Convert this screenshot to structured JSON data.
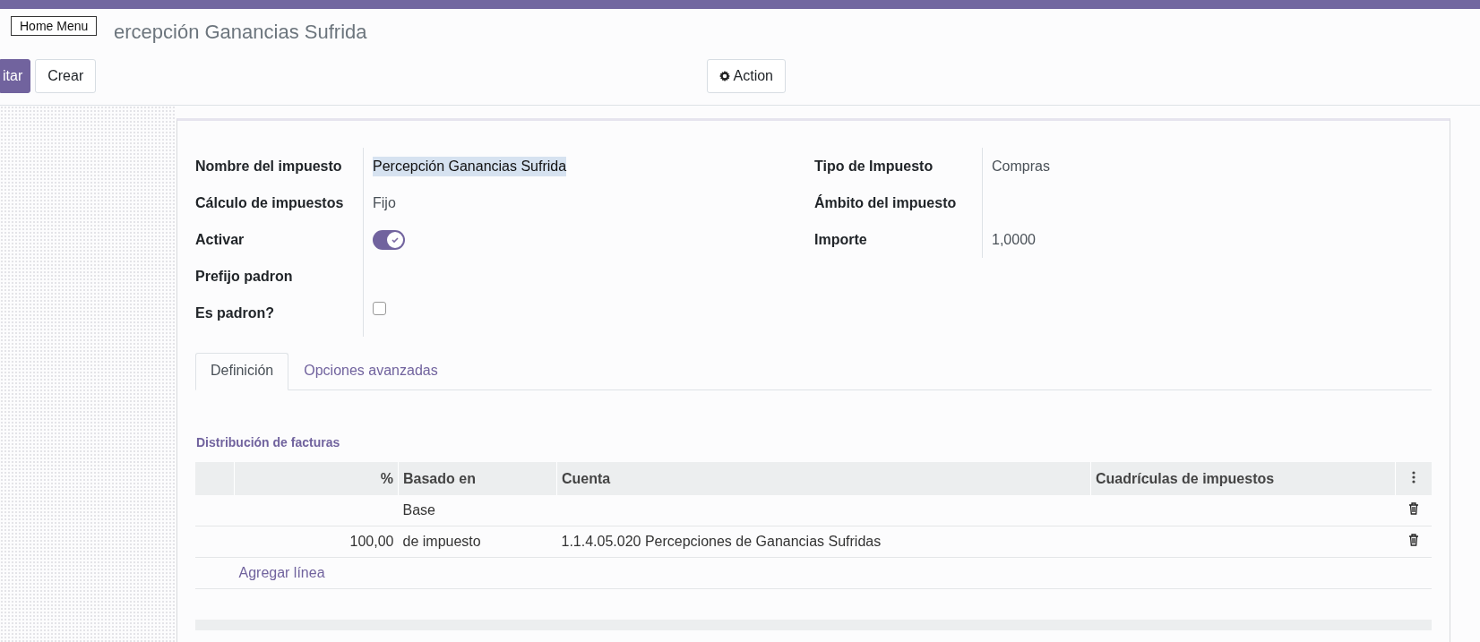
{
  "tooltip": "Home Menu",
  "breadcrumb": "ercepción Ganancias Sufrida",
  "buttons": [
    {
      "label": "itar",
      "kind": "primary"
    },
    {
      "label": "Crear",
      "kind": "secondary"
    }
  ],
  "action_button": "Action",
  "fields_left": [
    {
      "label": "Nombre del impuesto",
      "kind": "text",
      "value": "Percepción Ganancias Sufrida",
      "highlighted": true
    },
    {
      "label": "Cálculo de impuestos",
      "kind": "text",
      "value": "Fijo"
    },
    {
      "label": "Activar",
      "kind": "toggle",
      "on": true
    },
    {
      "label": "Prefijo padron",
      "kind": "text"
    },
    {
      "label": "Es padron?",
      "kind": "checkbox",
      "checked": false
    }
  ],
  "fields_right": [
    {
      "label": "Tipo de Impuesto",
      "value": "Compras"
    },
    {
      "label": "Ámbito del impuesto"
    },
    {
      "label": "Importe",
      "value": "1,0000"
    }
  ],
  "tabs": [
    {
      "label": "Definición",
      "selected": true
    },
    {
      "label": "Opciones avanzadas",
      "selected": false
    }
  ],
  "section_title": "Distribución de facturas",
  "table": {
    "columns": [
      "%",
      "Basado en",
      "Cuenta",
      "Cuadrículas de impuestos"
    ],
    "rows": [
      {
        "percent": "",
        "based_on": "Base",
        "account": "",
        "grids": ""
      },
      {
        "percent": "100,00",
        "based_on": "de impuesto",
        "account": "1.1.4.05.020 Percepciones de Ganancias Sufridas",
        "grids": ""
      }
    ],
    "add_line": "Agregar línea"
  }
}
